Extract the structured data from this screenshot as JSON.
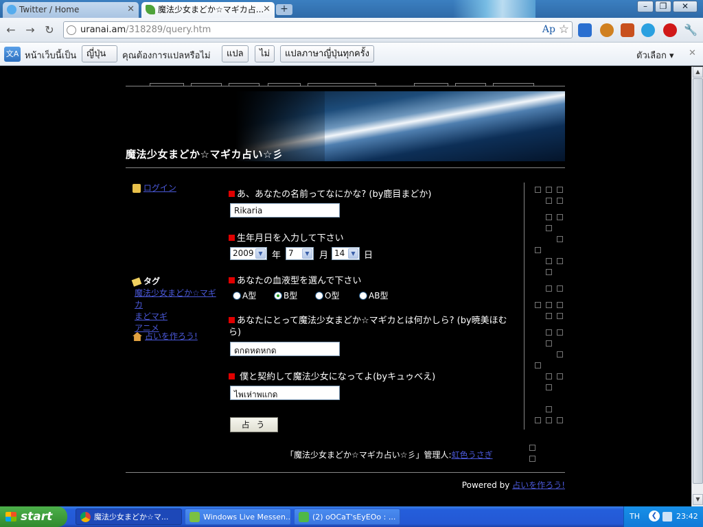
{
  "browser": {
    "tabs": [
      {
        "title": "Twitter / Home"
      },
      {
        "title": "魔法少女まどか☆マギカ占..."
      }
    ],
    "url_host": "uranai.am",
    "url_path": "/318289/query.htm",
    "ap_label": "Ap"
  },
  "translate_bar": {
    "prefix": "หน้าเว็บนี้เป็น",
    "language": "ญี่ปุ่น",
    "question": "คุณต้องการแปลหรือไม่",
    "translate_button": "แปล",
    "no_button": "ไม่",
    "always_button": "แปลภาษาญี่ปุ่นทุกครั้ง",
    "options_label": "ตัวเลือก"
  },
  "site": {
    "title": "魔法少女まどか☆マギカ占い☆彡",
    "login_link": "ログイン",
    "tag_heading": "タグ",
    "tags": [
      "魔法少女まどか☆マギカ",
      "まどマギ",
      "アニメ"
    ],
    "make_link": "占いを作ろう!",
    "footer_prefix": "「魔法少女まどか☆マギカ占い☆彡」管理人:",
    "footer_admin": "虹色うさぎ",
    "powered_by": "Powered by",
    "powered_link": "占いを作ろう!"
  },
  "form": {
    "q1": "あ、あなたの名前ってなにかな? (by鹿目まどか)",
    "name_value": "Rikaria",
    "q2": "生年月日を入力して下さい",
    "year_value": "2009",
    "year_unit": "年",
    "month_value": "7",
    "month_unit": "月",
    "day_value": "14",
    "day_unit": "日",
    "q3": "あなたの血液型を選んで下さい",
    "blood_types": [
      "A型",
      "B型",
      "O型",
      "AB型"
    ],
    "blood_selected": "B型",
    "q4": "あなたにとって魔法少女まどか☆マギカとは何かしら? (by暁美ほむら)",
    "q4_value": "ดกดหดหกด",
    "q5": "僕と契約して魔法少女になってよ(byキュゥべえ)",
    "q5_value": "ไพเห่าพแกด",
    "submit_label": "占 う"
  },
  "taskbar": {
    "start_label": "start",
    "tasks": [
      {
        "title": "魔法少女まどか☆マ..."
      },
      {
        "title": "Windows Live Messen..."
      },
      {
        "title": "(2) oOCaT'sEyEOo : ..."
      }
    ],
    "lang": "TH",
    "time": "23:42"
  },
  "colors": {
    "page_bg": "#000000",
    "bullet": "#e00000",
    "link": "#4a58d8",
    "chrome_frame": "#2f6aa8",
    "taskbar": "#245edb"
  }
}
